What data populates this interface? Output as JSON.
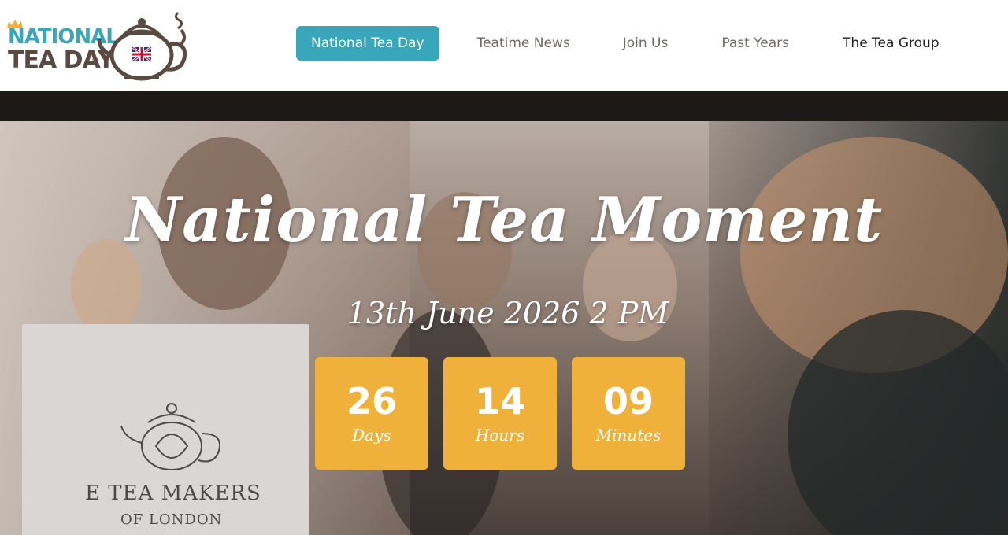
{
  "logo": {
    "line1": "NATIONAL",
    "line2": "TEA DAY",
    "reg": "®"
  },
  "nav": {
    "items": [
      {
        "label": "National Tea Day",
        "active": true
      },
      {
        "label": "Teatime News"
      },
      {
        "label": "Join Us"
      },
      {
        "label": "Past Years"
      },
      {
        "label": "The Tea Group"
      }
    ]
  },
  "hero": {
    "title": "National Tea Moment",
    "date": "13th June 2026 2 PM",
    "sign_line1": "E TEA MAKERS",
    "sign_line2": "OF LONDON"
  },
  "countdown": [
    {
      "value": "26",
      "label": "Days"
    },
    {
      "value": "14",
      "label": "Hours"
    },
    {
      "value": "09",
      "label": "Minutes"
    }
  ],
  "colors": {
    "accent": "#3aa6b9",
    "countdown_bg": "#f0b13a",
    "logo_brown": "#5a4a42",
    "band": "#1d1916"
  }
}
